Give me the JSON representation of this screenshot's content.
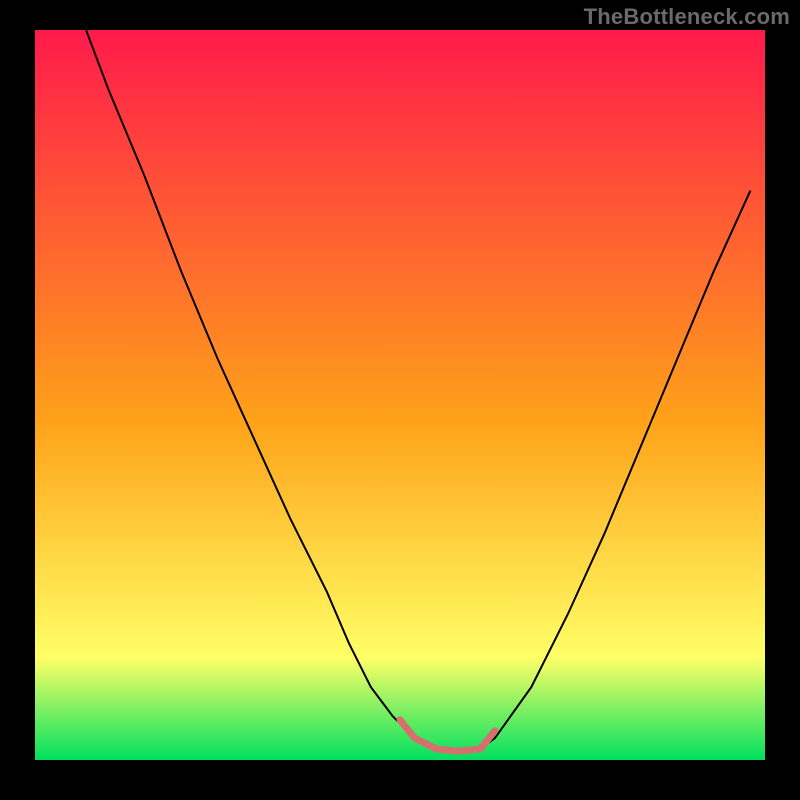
{
  "watermark": "TheBottleneck.com",
  "chart_data": {
    "type": "line",
    "title": "",
    "xlabel": "",
    "ylabel": "",
    "xlim": [
      0,
      100
    ],
    "ylim": [
      0,
      100
    ],
    "grid": false,
    "legend": false,
    "background_gradient": {
      "top_color": "#ff1a4b",
      "mid_color": "#ffa319",
      "lower_color": "#ffff66",
      "bottom_color": "#00e060"
    },
    "series": [
      {
        "name": "bottleneck-curve",
        "color": "#000000",
        "stroke_width": 2,
        "x": [
          7,
          10,
          15,
          20,
          25,
          30,
          35,
          40,
          43,
          46,
          49,
          52,
          55,
          58,
          61,
          63,
          68,
          73,
          78,
          83,
          88,
          93,
          98
        ],
        "y": [
          100,
          92,
          80,
          67,
          55,
          44,
          33,
          23,
          16,
          10,
          6,
          3,
          1.5,
          1.2,
          1.5,
          3,
          10,
          20,
          31,
          43,
          55,
          67,
          78
        ]
      },
      {
        "name": "optimal-zone-marker",
        "color": "#d6706f",
        "stroke_width": 7,
        "stroke_linecap": "round",
        "x": [
          50,
          52,
          55,
          58,
          61,
          63
        ],
        "y": [
          5.5,
          3,
          1.5,
          1.2,
          1.5,
          4
        ]
      }
    ]
  }
}
